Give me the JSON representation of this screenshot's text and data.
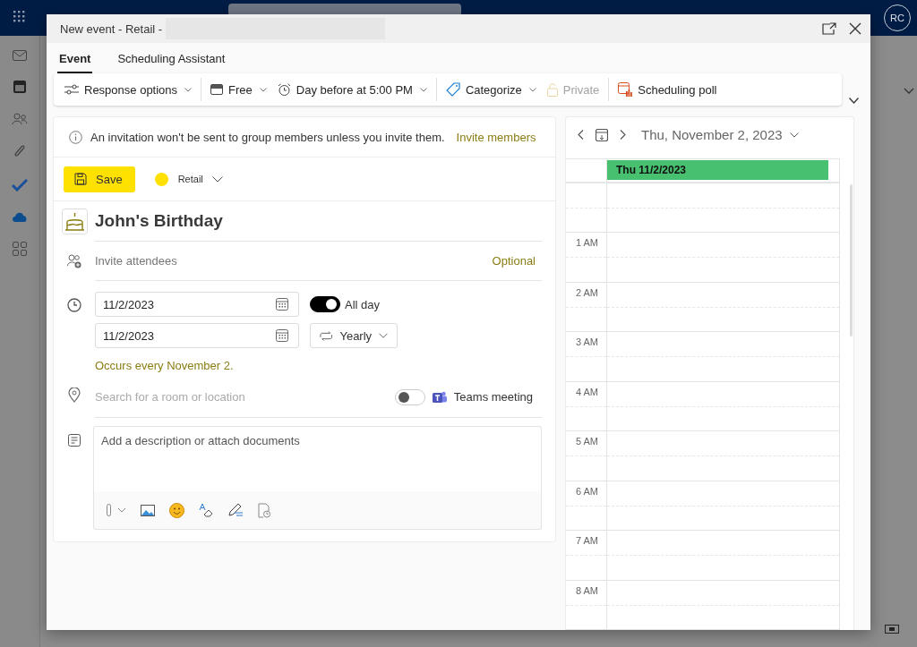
{
  "app": {
    "avatar": "RC"
  },
  "window": {
    "title": "New event - Retail -"
  },
  "tabs": [
    {
      "label": "Event",
      "selected": true
    },
    {
      "label": "Scheduling Assistant",
      "selected": false
    }
  ],
  "toolbar": {
    "groups": [
      {
        "items": [
          {
            "kind": "options",
            "label": "Response options",
            "dropdown": true,
            "disabled": false
          }
        ]
      },
      {
        "items": [
          {
            "kind": "status",
            "label": "Free",
            "dropdown": true,
            "disabled": false
          },
          {
            "kind": "reminder",
            "label": "Day before at 5:00 PM",
            "dropdown": true,
            "disabled": false
          }
        ]
      },
      {
        "items": [
          {
            "kind": "categorize",
            "label": "Categorize",
            "dropdown": true,
            "disabled": false
          },
          {
            "kind": "private",
            "label": "Private",
            "dropdown": false,
            "disabled": true
          }
        ]
      },
      {
        "items": [
          {
            "kind": "poll",
            "label": "Scheduling poll",
            "dropdown": false,
            "disabled": false
          }
        ]
      }
    ]
  },
  "notice": {
    "text": "An invitation won't be sent to group members unless you invite them.",
    "link": "Invite members"
  },
  "save_button": "Save",
  "calendar_choice": {
    "name": "Retail",
    "color": "#ffe000"
  },
  "event_title": "John's Birthday",
  "attendees": {
    "placeholder": "Invite attendees",
    "optional_link": "Optional"
  },
  "start_date": "11/2/2023",
  "end_date": "11/2/2023",
  "all_day": {
    "label": "All day",
    "on": true
  },
  "recurrence": {
    "label": "Yearly",
    "summary": "Occurs every November 2."
  },
  "location": {
    "placeholder": "Search for a room or location"
  },
  "teams_meeting": {
    "label": "Teams meeting",
    "on": false
  },
  "description": {
    "placeholder": "Add a description or attach documents"
  },
  "day_view": {
    "date_title": "Thu, November 2, 2023",
    "events": [
      {
        "label": "Thu 11/2/2023",
        "color": "#47c16f"
      }
    ],
    "hours": [
      "1 AM",
      "2 AM",
      "3 AM",
      "4 AM",
      "5 AM",
      "6 AM",
      "7 AM",
      "8 AM"
    ]
  }
}
